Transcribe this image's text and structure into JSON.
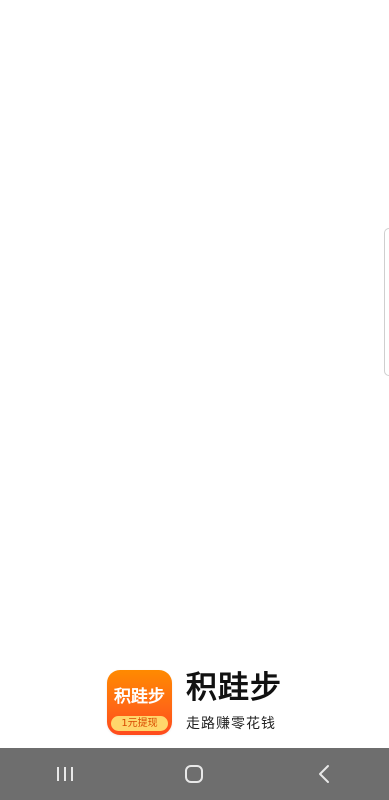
{
  "splash": {
    "app_icon": {
      "title": "积跬步",
      "ribbon": "1元提现",
      "gradient_top": "#ff8a00",
      "gradient_bottom": "#ff4a1c",
      "ribbon_color": "#ffd66b"
    },
    "brand_name": "积跬步",
    "slogan": "走路赚零花钱"
  },
  "system_nav": {
    "background": "#6e6e6e",
    "buttons": [
      {
        "icon": "recent-apps-icon"
      },
      {
        "icon": "home-icon"
      },
      {
        "icon": "back-icon"
      }
    ]
  }
}
